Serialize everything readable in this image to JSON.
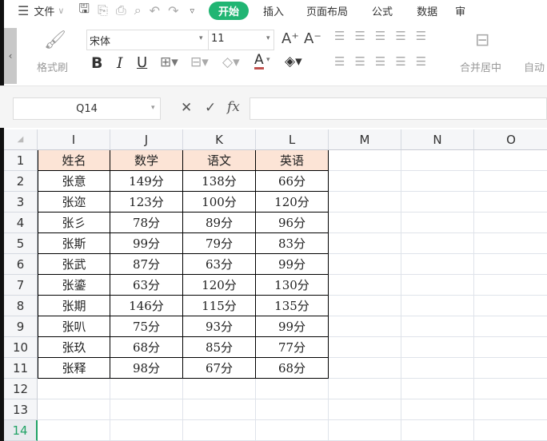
{
  "menubar": {
    "menu_label": "文件",
    "tabs": [
      "开始",
      "插入",
      "页面布局",
      "公式",
      "数据",
      "审"
    ]
  },
  "ribbon": {
    "format_painter": "格式刷",
    "font_name": "宋体",
    "font_size": "11",
    "merge_center": "合并居中",
    "auto_wrap": "自动",
    "font_color": "#c0504d"
  },
  "formula_bar": {
    "name_box": "Q14",
    "fx": "fx",
    "value": ""
  },
  "columns": [
    "I",
    "J",
    "K",
    "L",
    "M",
    "N",
    "O"
  ],
  "rows": [
    "1",
    "2",
    "3",
    "4",
    "5",
    "6",
    "7",
    "8",
    "9",
    "10",
    "11",
    "12",
    "13",
    "14"
  ],
  "selected_row": "14",
  "table": {
    "headers": [
      "姓名",
      "数学",
      "语文",
      "英语"
    ],
    "header_fill": "#fce4d6",
    "data": [
      [
        "张意",
        "149分",
        "138分",
        "66分"
      ],
      [
        "张迩",
        "123分",
        "100分",
        "120分"
      ],
      [
        "张彡",
        "78分",
        "89分",
        "96分"
      ],
      [
        "张斯",
        "99分",
        "79分",
        "83分"
      ],
      [
        "张武",
        "87分",
        "63分",
        "99分"
      ],
      [
        "张鎏",
        "63分",
        "120分",
        "130分"
      ],
      [
        "张期",
        "146分",
        "115分",
        "135分"
      ],
      [
        "张叭",
        "75分",
        "93分",
        "99分"
      ],
      [
        "张玖",
        "68分",
        "85分",
        "77分"
      ],
      [
        "张释",
        "98分",
        "67分",
        "68分"
      ]
    ]
  }
}
